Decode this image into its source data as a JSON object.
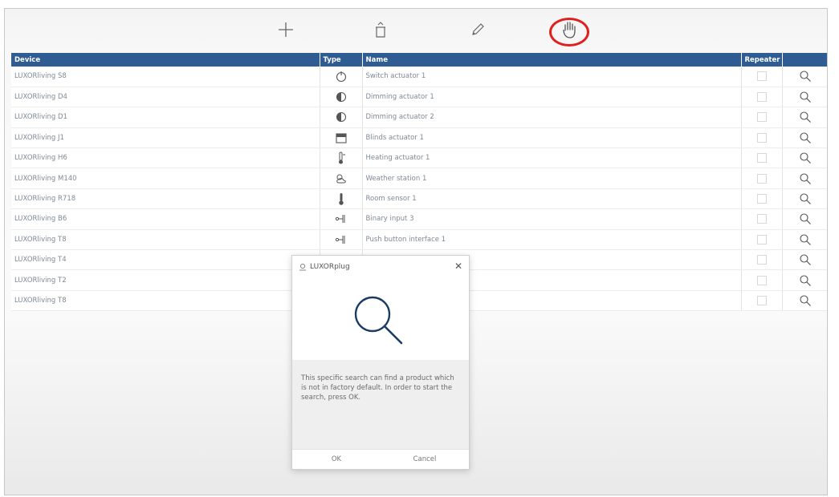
{
  "toolbar": {
    "buttons": [
      {
        "icon": "plus-icon"
      },
      {
        "icon": "trash-icon"
      },
      {
        "icon": "pencil-icon"
      },
      {
        "icon": "hand-icon"
      }
    ],
    "highlight_color": "#e0201f"
  },
  "table": {
    "headers": [
      "Device",
      "Type",
      "Name",
      "Repeater",
      ""
    ],
    "header_color": "#2f5d93",
    "rows": [
      {
        "device": "LUXORliving S8",
        "type_icon": "switch-actuator-icon",
        "name": "Switch actuator 1"
      },
      {
        "device": "LUXORliving D4",
        "type_icon": "dimming-actuator-icon",
        "name": "Dimming actuator 1"
      },
      {
        "device": "LUXORliving D1",
        "type_icon": "dimming-actuator-icon",
        "name": "Dimming actuator 2"
      },
      {
        "device": "LUXORliving J1",
        "type_icon": "blinds-actuator-icon",
        "name": "Blinds actuator 1"
      },
      {
        "device": "LUXORliving H6",
        "type_icon": "heating-actuator-icon",
        "name": "Heating actuator 1"
      },
      {
        "device": "LUXORliving M140",
        "type_icon": "weather-station-icon",
        "name": "Weather station 1"
      },
      {
        "device": "LUXORliving R718",
        "type_icon": "room-sensor-icon",
        "name": "Room sensor 1"
      },
      {
        "device": "LUXORliving B6",
        "type_icon": "binary-input-icon",
        "name": "Binary input 3"
      },
      {
        "device": "LUXORliving T8",
        "type_icon": "push-button-icon",
        "name": "Push button interface 1"
      },
      {
        "device": "LUXORliving T4",
        "type_icon": "",
        "name": ""
      },
      {
        "device": "LUXORliving T2",
        "type_icon": "",
        "name": ""
      },
      {
        "device": "LUXORliving T8",
        "type_icon": "",
        "name": ""
      }
    ]
  },
  "dialog": {
    "title": "LUXORplug",
    "icon": "magnifier-icon",
    "message": "This specific search can find a product which is not in factory default. In order to start the search, press OK.",
    "ok_label": "OK",
    "cancel_label": "Cancel"
  }
}
